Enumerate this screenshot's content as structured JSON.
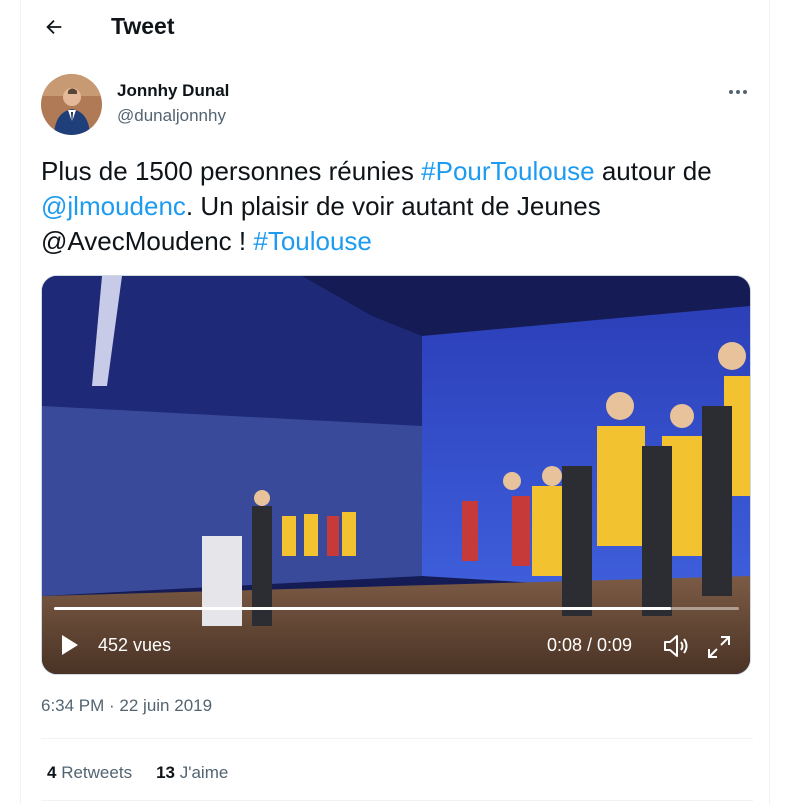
{
  "header": {
    "title": "Tweet",
    "back_icon": "arrow-left-icon"
  },
  "tweet": {
    "author": {
      "name": "Jonnhy Dunal",
      "handle": "@dunaljonnhy"
    },
    "more_icon": "ellipsis-icon",
    "text": {
      "part1": "Plus de 1500 personnes réunies ",
      "hashtag1": "#PourToulouse",
      "part2": " autour de ",
      "mention1": "@jlmoudenc",
      "part3": ". Un plaisir de voir autant de Jeunes @AvecMoudenc ! ",
      "hashtag2": "#Toulouse"
    },
    "video": {
      "views": "452 vues",
      "time": "0:08 / 0:09",
      "progress": 0.9,
      "play_icon": "play-icon",
      "volume_icon": "volume-icon",
      "fullscreen_icon": "fullscreen-icon"
    },
    "timestamp": "6:34 PM · 22 juin 2019",
    "stats": {
      "retweets_count": "4",
      "retweets_label": "Retweets",
      "likes_count": "13",
      "likes_label": "J'aime"
    }
  },
  "colors": {
    "accent": "#1d9bf0",
    "text": "#0f1419",
    "secondary": "#536471"
  }
}
